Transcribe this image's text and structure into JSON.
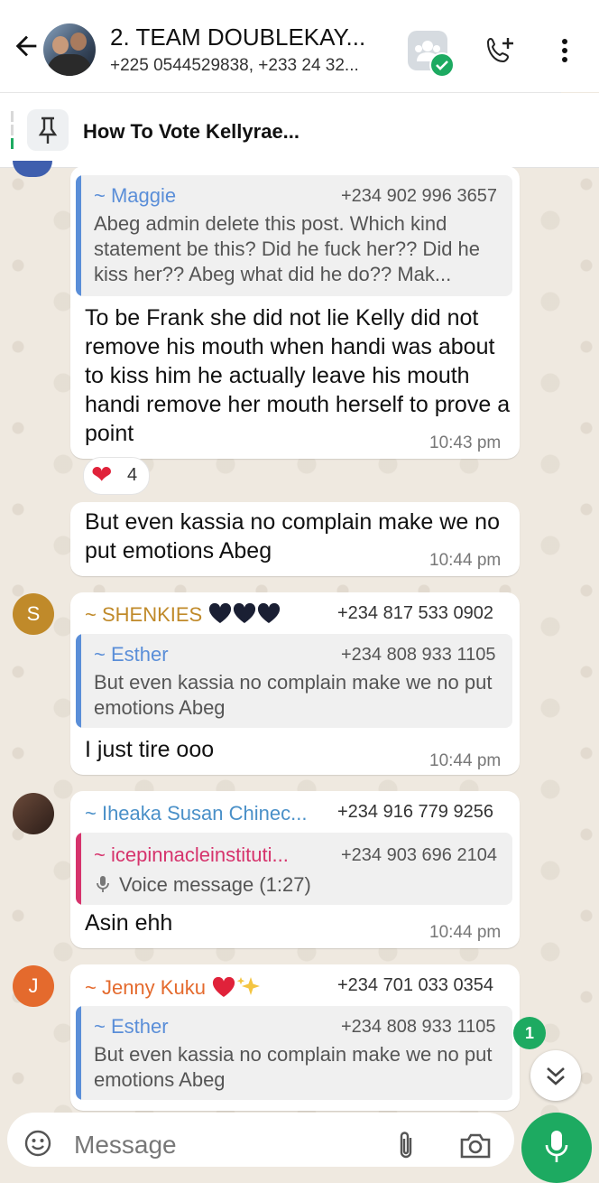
{
  "header": {
    "title": "2. TEAM DOUBLEKAY...",
    "subtitle": "+225 0544529838, +233 24 32..."
  },
  "pinned": {
    "text": "How To Vote Kellyrae..."
  },
  "messages": [
    {
      "quote_name": "~ Maggie",
      "quote_phone": "+234 902 996 3657",
      "quote_text": "Abeg admin delete this post. Which kind statement be this? Did he fuck her?? Did he kiss her?? Abeg what did he do?? Mak...",
      "text": "To be Frank she did not lie Kelly did not remove his mouth when handi was about to kiss him he actually leave his mouth handi remove her mouth herself to prove a point",
      "time": "10:43 pm",
      "reaction_count": "4"
    },
    {
      "text": "But even  kassia no complain make we no put emotions Abeg",
      "time": "10:44 pm"
    },
    {
      "avatar_letter": "S",
      "sender": "~ SHENKIES",
      "sender_phone": "+234 817 533 0902",
      "quote_name": "~ Esther",
      "quote_phone": "+234 808 933 1105",
      "quote_text": "But even  kassia no complain make we no put emotions Abeg",
      "text": "I just tire ooo",
      "time": "10:44 pm"
    },
    {
      "sender": "~ Iheaka Susan Chinec...",
      "sender_phone": "+234 916 779 9256",
      "quote_name": "~ icepinnacleinstituti...",
      "quote_phone": "+234 903 696 2104",
      "quote_text": "Voice message (1:27)",
      "text": "Asin ehh",
      "time": "10:44 pm"
    },
    {
      "avatar_letter": "J",
      "sender": "~ Jenny Kuku",
      "sender_phone": "+234 701 033 0354",
      "quote_name": "~ Esther",
      "quote_phone": "+234 808 933 1105",
      "quote_text": "But even  kassia no complain make we no put emotions Abeg"
    }
  ],
  "unread_badge": "1",
  "composer": {
    "placeholder": "Message"
  },
  "colors": {
    "brand_green": "#1daa61",
    "shenkies": "#c08a2a",
    "iheaka": "#4a90c8",
    "jenny": "#e46a2d",
    "maggie_quote": "#5a8ed8",
    "esther_quote": "#5a8ed8",
    "icepinnacle_quote": "#d6336c"
  },
  "icons": [
    "back-arrow-icon",
    "community-icon",
    "add-call-icon",
    "more-vert-icon",
    "pin-icon",
    "heart-emoji",
    "double-chevron-down-icon",
    "emoji-icon",
    "attach-icon",
    "camera-icon",
    "mic-icon"
  ]
}
